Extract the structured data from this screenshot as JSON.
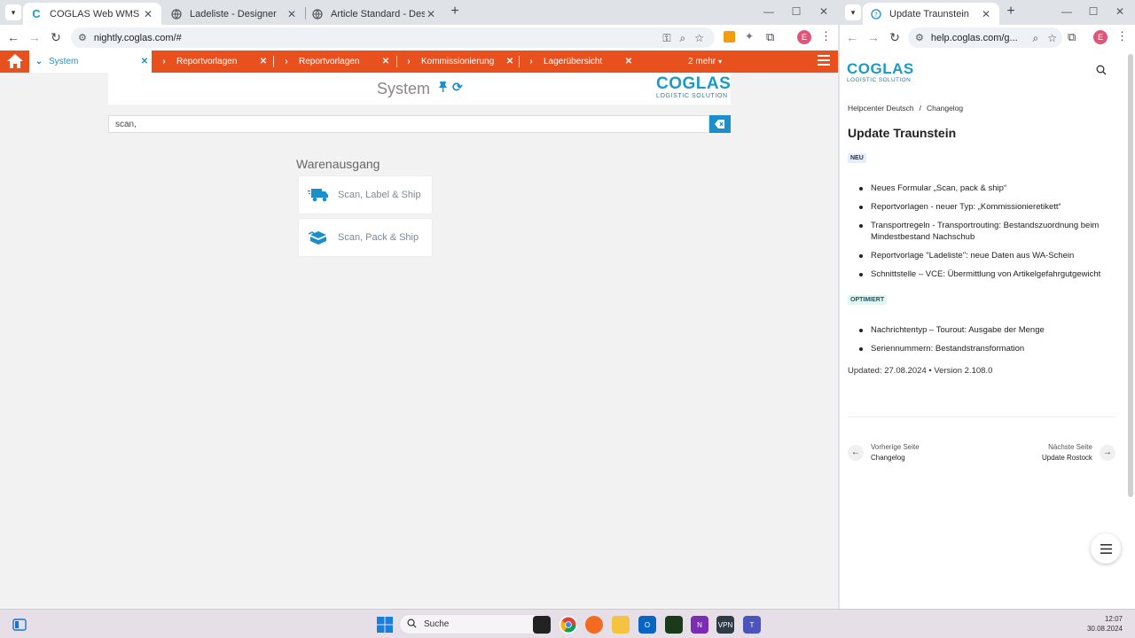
{
  "left_browser": {
    "tabs": [
      {
        "label": "COGLAS Web WMS",
        "active": true
      },
      {
        "label": "Ladeliste - Designer",
        "active": false
      },
      {
        "label": "Article Standard - Designer",
        "active": false
      }
    ],
    "url": "nightly.coglas.com/#",
    "avatar_letter": "E"
  },
  "wms": {
    "tabs": [
      {
        "label": "System",
        "selected": true
      },
      {
        "label": "Reportvorlagen"
      },
      {
        "label": "Reportvorlagen"
      },
      {
        "label": "Kommissionierung"
      },
      {
        "label": "Lagerübersicht"
      }
    ],
    "more_label": "2 mehr",
    "page_title": "System",
    "logo_main": "COGLAS",
    "logo_sub": "LOGISTIC SOLUTION",
    "search_value": "scan,",
    "section_title": "Warenausgang",
    "actions": [
      {
        "label": "Scan, Label & Ship",
        "icon": "delivery-truck-icon"
      },
      {
        "label": "Scan, Pack & Ship",
        "icon": "package-box-icon"
      }
    ]
  },
  "right_browser": {
    "tab_label": "Update Traunstein",
    "url": "help.coglas.com/g...",
    "avatar_letter": "E"
  },
  "help": {
    "logo_main": "COGLAS",
    "logo_sub": "LOGISTIC SOLUTION",
    "breadcrumb": [
      "Helpcenter Deutsch",
      "/",
      "Changelog"
    ],
    "title": "Update Traunstein",
    "badge_new": "NEU",
    "new_items": [
      "Neues Formular „Scan, pack & ship“",
      "Reportvorlagen - neuer Typ: „Kommissionieretikett“",
      "Transportregeln - Transportrouting: Bestandszuordnung beim Mindestbestand Nachschub",
      "Reportvorlage \"Ladeliste\": neue Daten aus WA-Schein",
      "Schnittstelle – VCE: Übermittlung von Artikelgefahrgutgewicht"
    ],
    "badge_opt": "OPTIMIERT",
    "opt_items": [
      "Nachrichtentyp – Tourout: Ausgabe der Menge",
      "Seriennummern: Bestandstransformation"
    ],
    "updated": "Updated: 27.08.2024 • Version 2.108.0",
    "prev_label": "Vorherige Seite",
    "prev_value": "Changelog",
    "next_label": "Nächste Seite",
    "next_value": "Update Rostock"
  },
  "taskbar": {
    "search_label": "Suche",
    "time": "12:07",
    "date": "30.08.2024"
  },
  "colors": {
    "wms_orange": "#e8501d",
    "coglas_blue": "#1a9bc7"
  }
}
